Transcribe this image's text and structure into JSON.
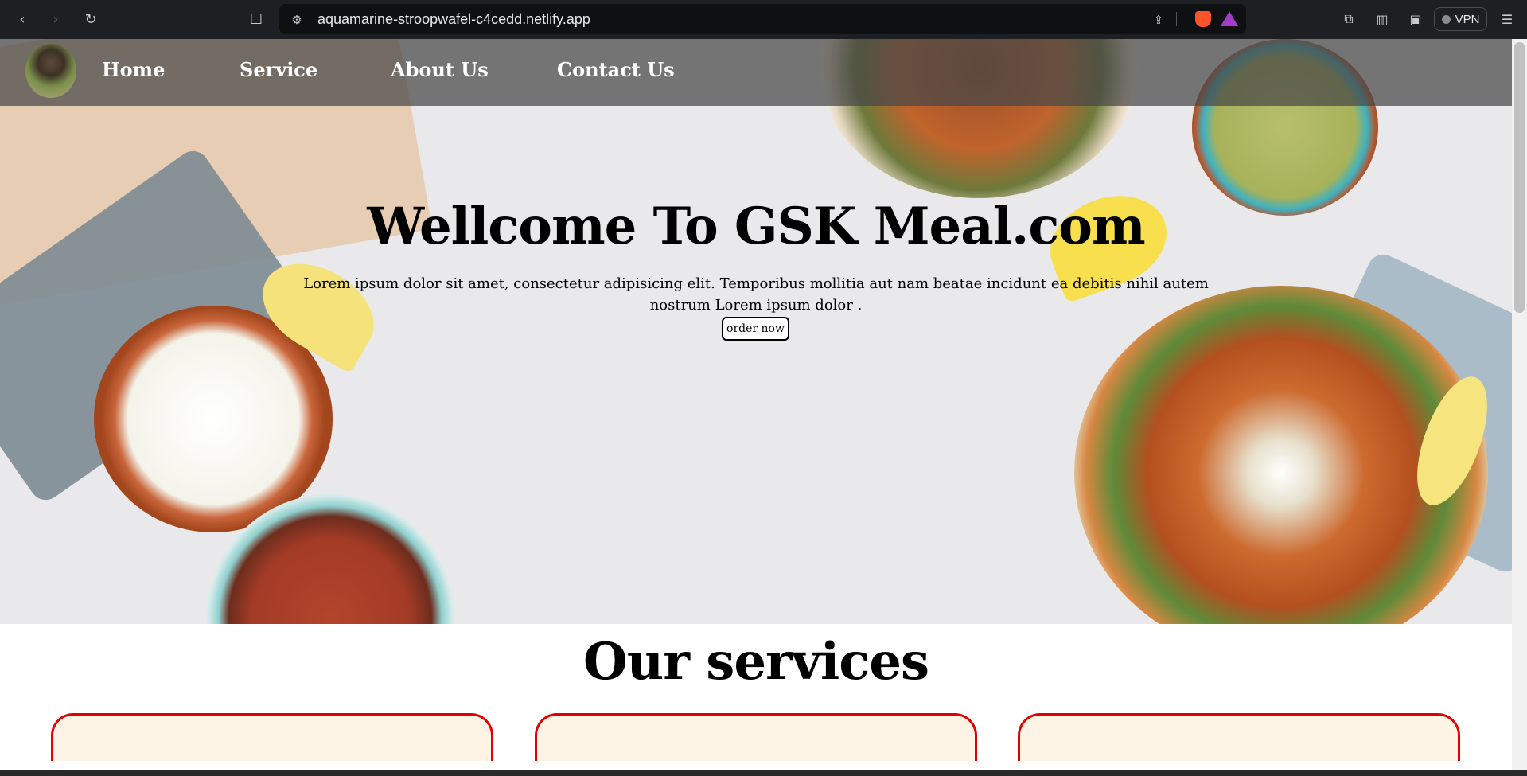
{
  "browser": {
    "url": "aquamarine-stroopwafel-c4cedd.netlify.app",
    "vpn_label": "VPN",
    "icons": {
      "back": "back-arrow-icon",
      "forward": "forward-arrow-icon",
      "reload": "reload-icon",
      "bookmark": "bookmark-icon",
      "site_settings": "site-settings-icon",
      "share": "share-icon",
      "extensions": "extensions-icon",
      "sidebar": "sidebar-icon",
      "wallet": "wallet-icon",
      "menu": "hamburger-menu-icon"
    }
  },
  "navbar": {
    "links": [
      "Home",
      "Service",
      "About Us",
      "Contact Us"
    ]
  },
  "hero": {
    "title": "Wellcome To GSK Meal.com",
    "text": "Lorem ipsum dolor sit amet, consectetur adipisicing elit. Temporibus mollitia aut nam beatae incidunt ea debitis nihil autem nostrum Lorem ipsum dolor .",
    "button_label": "order now"
  },
  "services": {
    "title": "Our services",
    "card_border_color": "#e30000"
  }
}
